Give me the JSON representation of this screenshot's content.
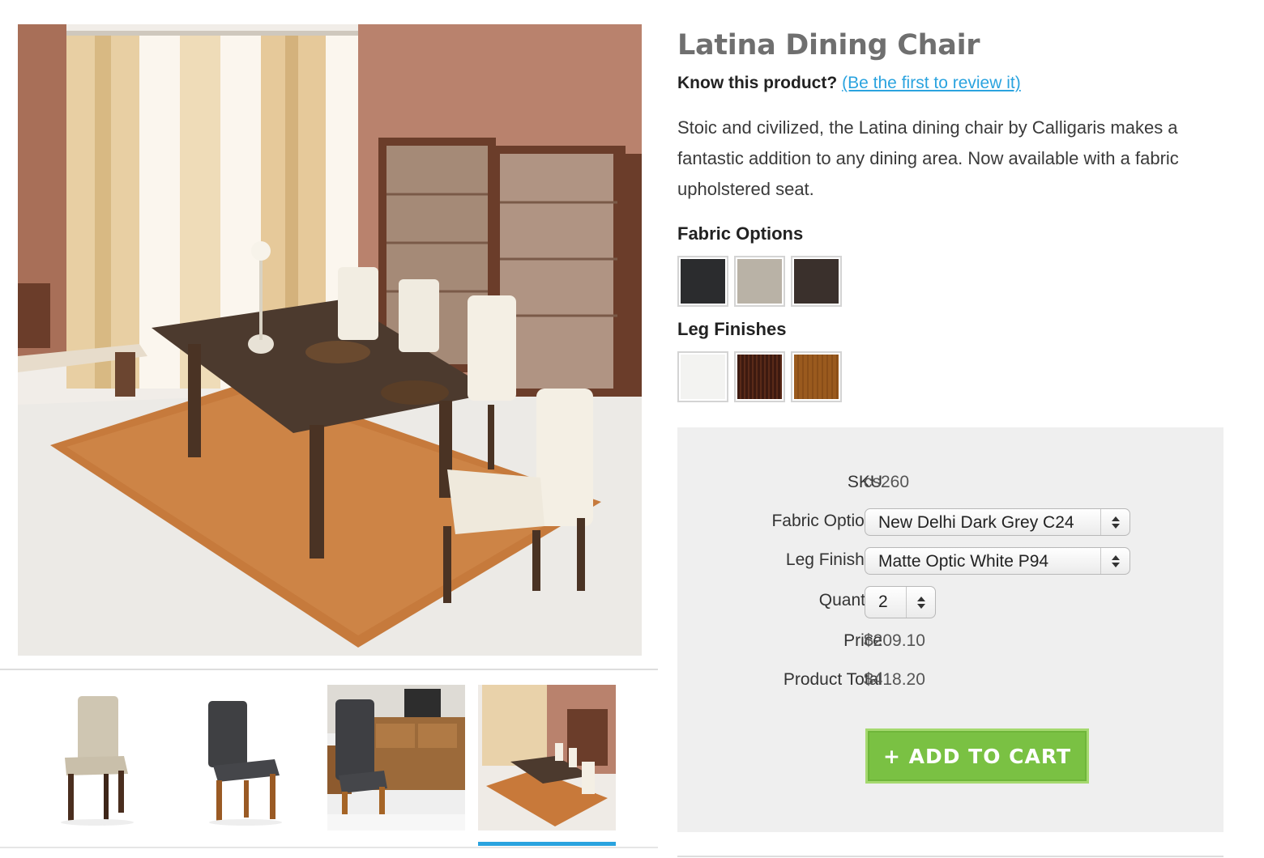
{
  "product": {
    "title": "Latina Dining Chair",
    "review_prompt": "Know this product?",
    "review_link": "(Be the first to review it)",
    "description": "Stoic and civilized, the Latina dining chair by Calligaris makes a fantastic addition to any dining area. Now available with a fabric upholstered seat."
  },
  "options": {
    "fabric_heading": "Fabric Options",
    "fabric_swatches": [
      "#2b2c2e",
      "#b9b2a6",
      "#3a302c"
    ],
    "leg_heading": "Leg Finishes",
    "leg_swatches": [
      "#f3f3f1",
      "#3d1a10",
      "#9a5a1e"
    ]
  },
  "purchase": {
    "sku_label": "SKU",
    "sku_value": "cs260",
    "fabric_label": "Fabric Options",
    "fabric_selected": "New Delhi Dark Grey C24",
    "leg_label": "Leg Finishes",
    "leg_selected": "Matte Optic White P94",
    "quantity_label": "Quantity",
    "quantity_selected": "2",
    "price_label": "Price",
    "price_value": "$209.10",
    "total_label": "Product Total",
    "total_value": "$418.20",
    "add_to_cart_label": "+ ADD TO CART"
  },
  "gallery": {
    "thumbnails": [
      "beige-chair-thumbnail",
      "dark-grey-chair-thumbnail",
      "chair-in-room-thumbnail",
      "dining-room-thumbnail"
    ],
    "active_index": 3
  },
  "colors": {
    "accent_link": "#2aa3df",
    "cart_button": "#7ac143",
    "panel_bg": "#efefef"
  }
}
